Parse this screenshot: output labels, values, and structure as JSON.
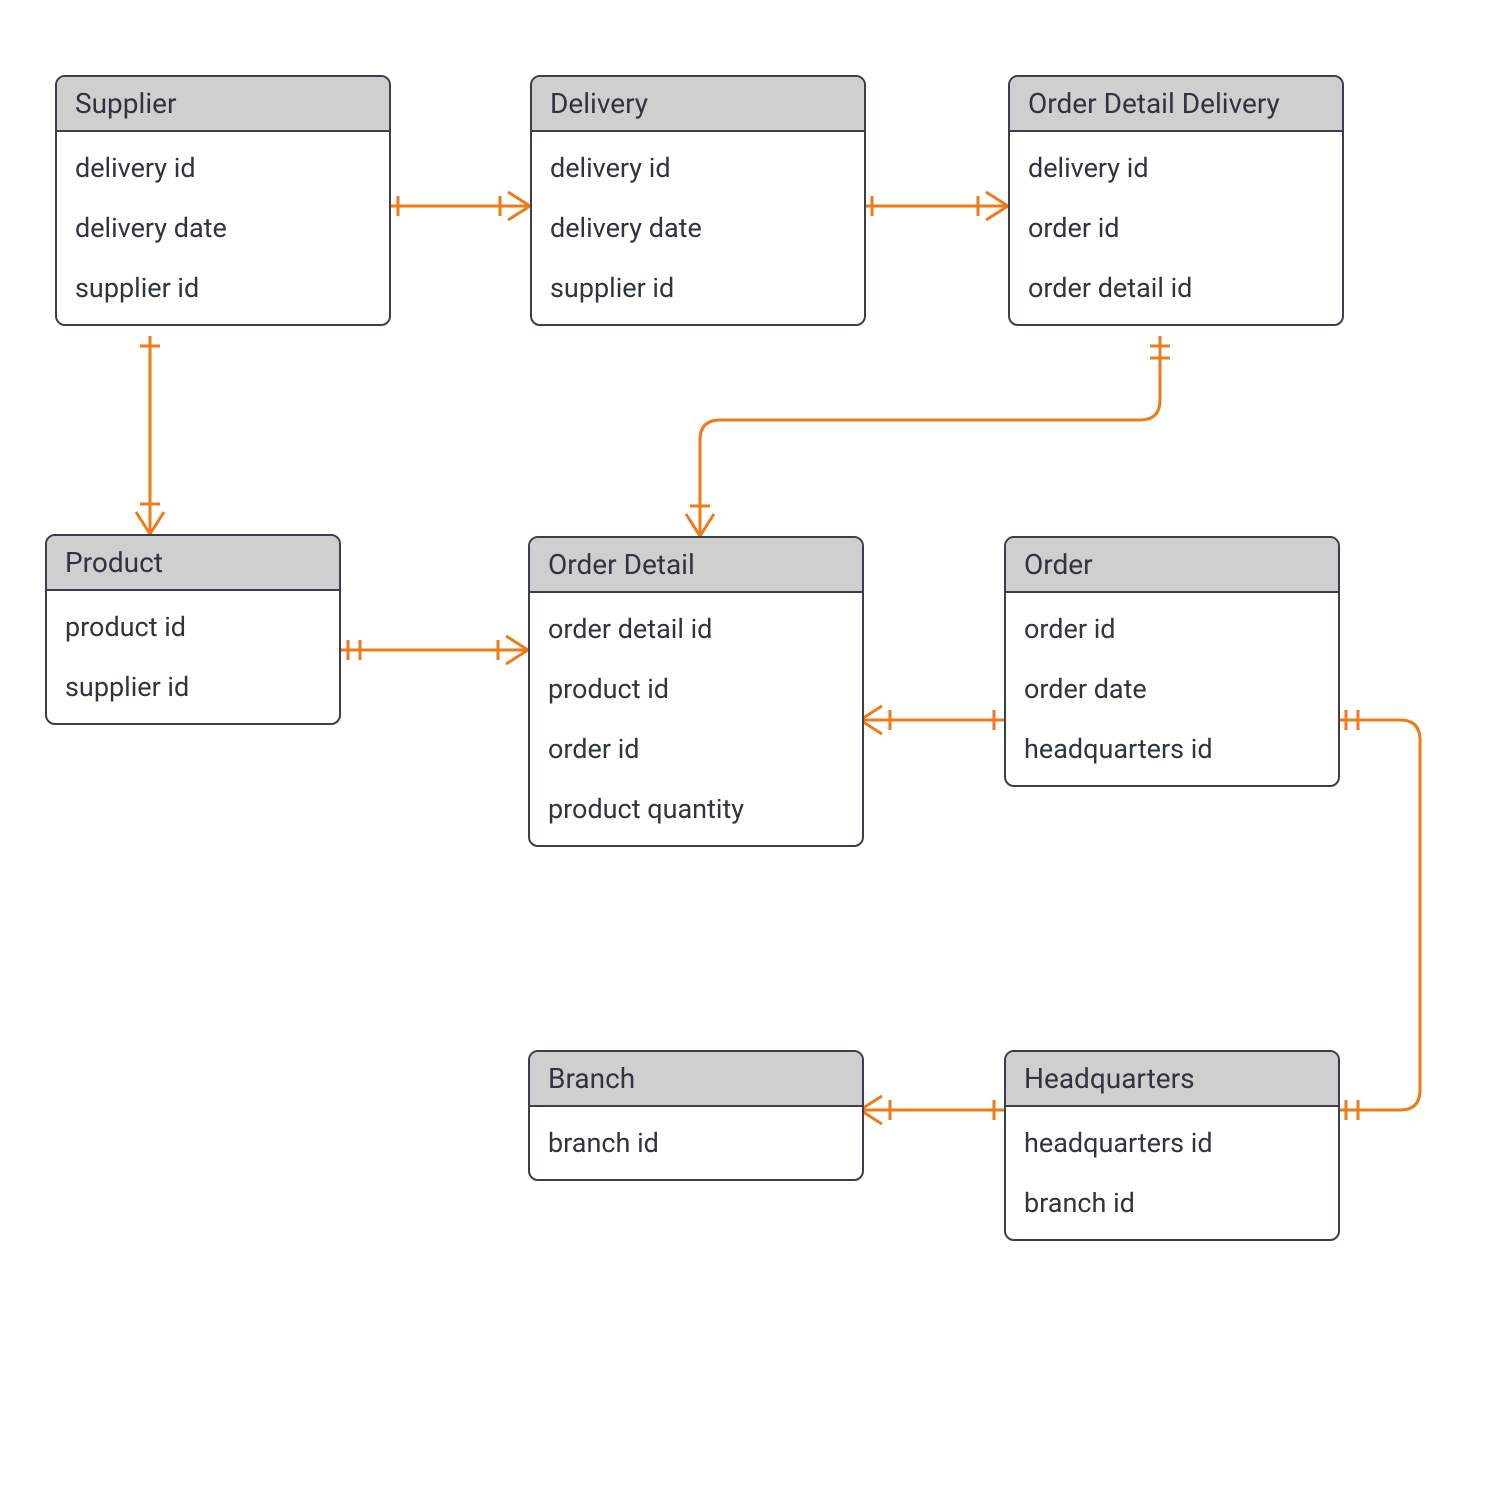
{
  "diagram_type": "entity-relationship",
  "colors": {
    "line": "#ee7b1a",
    "border": "#3a3f4b",
    "header_bg": "#cfcfcf"
  },
  "entities": [
    {
      "name": "Supplier",
      "attrs": [
        "delivery id",
        "delivery date",
        "supplier id"
      ]
    },
    {
      "name": "Delivery",
      "attrs": [
        "delivery id",
        "delivery date",
        "supplier id"
      ]
    },
    {
      "name": "Order Detail Delivery",
      "attrs": [
        "delivery id",
        "order id",
        "order detail id"
      ]
    },
    {
      "name": "Product",
      "attrs": [
        "product id",
        "supplier id"
      ]
    },
    {
      "name": "Order Detail",
      "attrs": [
        "order detail id",
        "product id",
        "order id",
        "product quantity"
      ]
    },
    {
      "name": "Order",
      "attrs": [
        "order id",
        "order date",
        "headquarters id"
      ]
    },
    {
      "name": "Branch",
      "attrs": [
        "branch id"
      ]
    },
    {
      "name": "Headquarters",
      "attrs": [
        "headquarters id",
        "branch id"
      ]
    }
  ],
  "relationships": [
    {
      "from": "Supplier",
      "to": "Delivery",
      "cardinality": "one-to-many"
    },
    {
      "from": "Delivery",
      "to": "Order Detail Delivery",
      "cardinality": "one-to-many"
    },
    {
      "from": "Supplier",
      "to": "Product",
      "cardinality": "one-to-many"
    },
    {
      "from": "Product",
      "to": "Order Detail",
      "cardinality": "one-to-many"
    },
    {
      "from": "Order",
      "to": "Order Detail",
      "cardinality": "one-to-many"
    },
    {
      "from": "Order Detail Delivery",
      "to": "Order Detail",
      "cardinality": "one-to-many"
    },
    {
      "from": "Order",
      "to": "Headquarters",
      "cardinality": "one-to-one"
    },
    {
      "from": "Headquarters",
      "to": "Branch",
      "cardinality": "one-to-many"
    }
  ]
}
